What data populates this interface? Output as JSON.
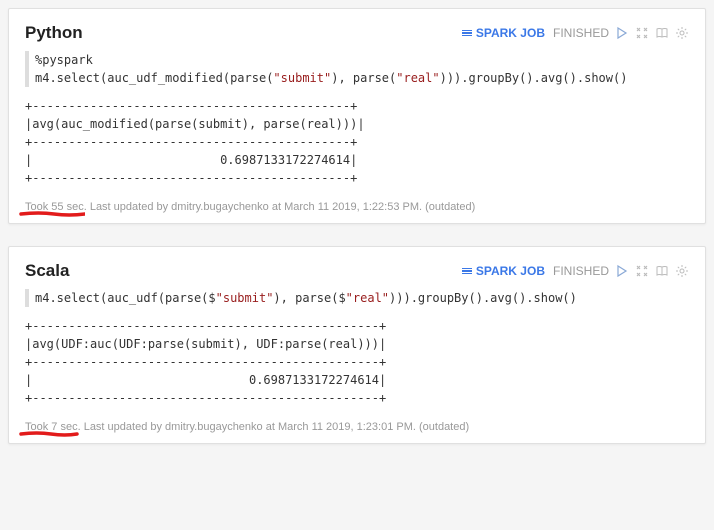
{
  "cells": [
    {
      "title": "Python",
      "spark_job_label": "SPARK JOB",
      "status": "FINISHED",
      "code_prefix": "%pyspark\n",
      "code_line": "m4.select(auc_udf_modified(parse(",
      "code_str1": "\"submit\"",
      "code_mid": "), parse(",
      "code_str2": "\"real\"",
      "code_end": "))).groupBy().avg().show()",
      "output": "+--------------------------------------------+\n|avg(auc_modified(parse(submit), parse(real)))|\n+--------------------------------------------+\n|                          0.6987133172274614|\n+--------------------------------------------+",
      "footer_took": "Took 55 sec.",
      "footer_rest": " Last updated by dmitry.bugaychenko at March 11 2019, 1:22:53 PM. (outdated)",
      "underline_width": 66
    },
    {
      "title": "Scala",
      "spark_job_label": "SPARK JOB",
      "status": "FINISHED",
      "code_prefix": "",
      "code_line": "m4.select(auc_udf(parse($",
      "code_str1": "\"submit\"",
      "code_mid": "), parse($",
      "code_str2": "\"real\"",
      "code_end": "))).groupBy().avg().show()",
      "output": "+------------------------------------------------+\n|avg(UDF:auc(UDF:parse(submit), UDF:parse(real)))|\n+------------------------------------------------+\n|                              0.6987133172274614|\n+------------------------------------------------+",
      "footer_took": "Took 7 sec.",
      "footer_rest": " Last updated by dmitry.bugaychenko at March 11 2019, 1:23:01 PM. (outdated)",
      "underline_width": 60
    }
  ]
}
